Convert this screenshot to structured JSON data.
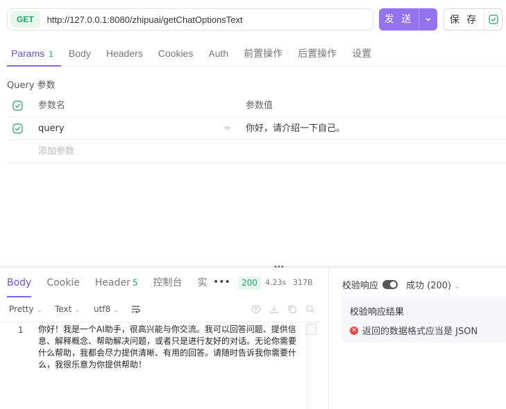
{
  "request": {
    "method": "GET",
    "url": "http://127.0.0.1:8080/zhipuai/getChatOptionsText",
    "send_label": "发 送",
    "save_label": "保 存"
  },
  "request_tabs": [
    {
      "label": "Params",
      "count": "1"
    },
    {
      "label": "Body"
    },
    {
      "label": "Headers"
    },
    {
      "label": "Cookies"
    },
    {
      "label": "Auth"
    },
    {
      "label": "前置操作"
    },
    {
      "label": "后置操作"
    },
    {
      "label": "设置"
    }
  ],
  "params": {
    "section_title": "Query 参数",
    "header_name": "参数名",
    "header_value": "参数值",
    "rows": [
      {
        "name": "query",
        "value": "你好，请介绍一下自己。"
      }
    ],
    "add_placeholder": "添加参数"
  },
  "response": {
    "tabs": [
      {
        "label": "Body"
      },
      {
        "label": "Cookie"
      },
      {
        "label": "Header",
        "count": "5"
      },
      {
        "label": "控制台"
      },
      {
        "label": "实"
      }
    ],
    "status_code": "200",
    "time": "4.23s",
    "size": "317B",
    "format": "Pretty",
    "type": "Text",
    "encoding": "utf8",
    "line_number": "1",
    "body_text": "你好！我是一个AI助手，很高兴能与你交流。我可以回答问题、提供信息、解释概念、帮助解决问题，或者只是进行友好的对话。无论你需要什么帮助，我都会尽力提供清晰、有用的回答。请随时告诉我你需要什么，我很乐意为你提供帮助！"
  },
  "validate": {
    "label": "校验响应",
    "enabled": true,
    "select_value": "成功 (200)",
    "result_title": "校验响应结果",
    "result_message": "返回的数据格式应当是 JSON"
  },
  "colors": {
    "accent": "#9373ee",
    "success": "#20a463",
    "error": "#e5484d"
  }
}
